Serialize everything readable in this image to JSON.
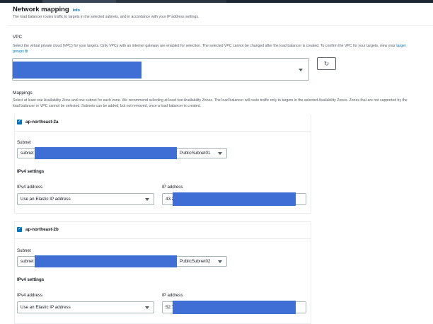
{
  "section": {
    "title": "Network mapping",
    "info_link": "Info",
    "description": "The load balancer routes traffic to targets in the selected subnets, and in accordance with your IP address settings."
  },
  "vpc": {
    "label": "VPC",
    "description_part1": "Select the virtual private cloud (VPC) for your targets. Only VPCs with an internet gateway are enabled for selection. The selected VPC cannot be changed after the load balancer is created. To confirm the VPC for your targets, view your",
    "description_link": "target groups",
    "refresh_icon": "refresh-icon"
  },
  "mappings": {
    "label": "Mappings",
    "description": "Select at least one Availability Zone and one subnet for each zone. We recommend selecting at least two Availability Zones. The load balancer will route traffic only to targets in the selected Availability Zones. Zones that are not supported by the load balancer or VPC cannot be selected. Subnets can be added, but not removed, once a load balancer is created."
  },
  "zones": [
    {
      "name": "ap-northeast-2a",
      "subnet_label": "Subnet",
      "subnet_prefix": "subnet",
      "subnet_suffix": "PublicSubnet01",
      "ipv4_settings_label": "IPv4 settings",
      "ipv4_address_label": "IPv4 address",
      "ipv4_address_value": "Use an Elastic IP address",
      "ip_address_label": "IP address",
      "ip_address_prefix": "43.2"
    },
    {
      "name": "ap-northeast-2b",
      "subnet_label": "Subnet",
      "subnet_prefix": "subnet",
      "subnet_suffix": "PublicSubnet02",
      "ipv4_settings_label": "IPv4 settings",
      "ipv4_address_label": "IPv4 address",
      "ipv4_address_value": "Use an Elastic IP address",
      "ip_address_label": "IP address",
      "ip_address_prefix": "52.7"
    }
  ],
  "colors": {
    "accent": "#0073bb",
    "redaction": "#3f6fd4"
  }
}
